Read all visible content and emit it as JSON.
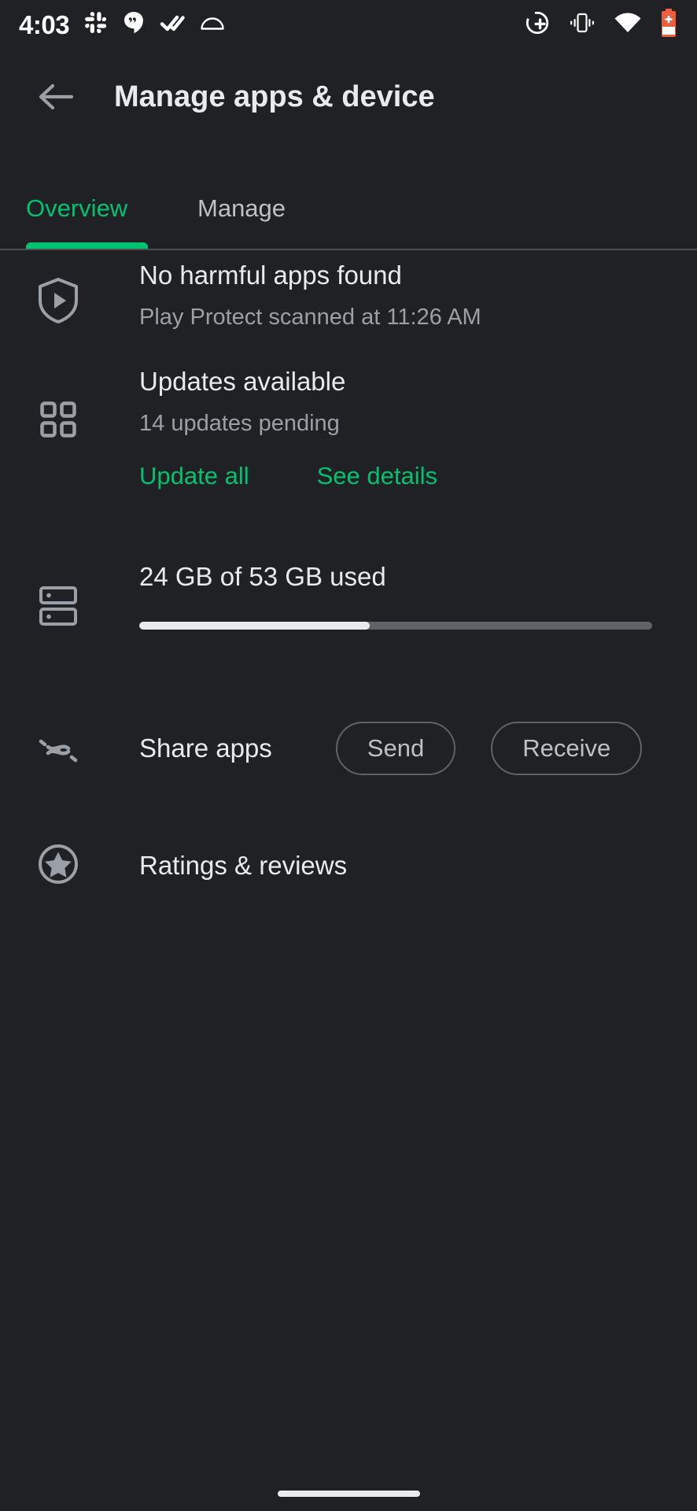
{
  "status_bar": {
    "clock": "4:03",
    "left_icons": [
      {
        "name": "slack-icon",
        "label": "Slack"
      },
      {
        "name": "chat-bubble-icon",
        "label": "Messages"
      },
      {
        "name": "checkmark-icon",
        "label": "Tasks"
      },
      {
        "name": "dome-icon",
        "label": "Notification"
      }
    ],
    "right_icons": [
      {
        "name": "location-add-icon",
        "label": "Location"
      },
      {
        "name": "vibrate-icon",
        "label": "Vibrate mode"
      },
      {
        "name": "wifi-icon",
        "label": "Wi-Fi"
      },
      {
        "name": "battery-saver-icon",
        "label": "Battery saver"
      }
    ],
    "battery_color": "#ee5d3c"
  },
  "app_bar": {
    "back_label": "Back",
    "title": "Manage apps & device"
  },
  "tabs": {
    "active_index": 0,
    "items": [
      {
        "label": "Overview",
        "name": "tab-overview"
      },
      {
        "label": "Manage",
        "name": "tab-manage"
      }
    ],
    "accent_color": "#00c271",
    "inactive_color": "#bdc1c6"
  },
  "sections": {
    "play_protect": {
      "icon": "shield-play-icon",
      "title": "No harmful apps found",
      "subtitle": "Play Protect scanned at 11:26 AM"
    },
    "updates": {
      "icon": "apps-grid-icon",
      "title": "Updates available",
      "subtitle": "14 updates pending",
      "update_all_label": "Update all",
      "see_details_label": "See details"
    },
    "storage": {
      "icon": "storage-icon",
      "title": "24 GB of 53 GB used",
      "used_gb": 24,
      "total_gb": 53,
      "percent_used": 45
    },
    "share": {
      "icon": "nearby-share-icon",
      "label": "Share apps",
      "send_label": "Send",
      "receive_label": "Receive"
    },
    "ratings": {
      "icon": "star-circle-icon",
      "label": "Ratings & reviews"
    }
  },
  "navigation": {
    "gesture_bar": "home-gesture-bar"
  }
}
